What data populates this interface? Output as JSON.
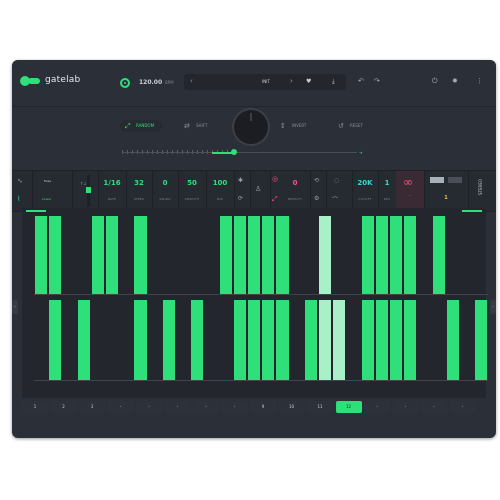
{
  "header": {
    "brand": "gatelab",
    "bpm": "120.00",
    "bpm_unit": "BPM",
    "preset_name": "INIT",
    "prev_arrow": "‹",
    "next_arrow": "›",
    "heart_icon": "♥",
    "download_icon": "⤓",
    "undo_icon": "↶",
    "redo_icon": "↷",
    "power_icon": "⏻",
    "settings_icon": "✹",
    "menu_icon": "⋮"
  },
  "modes": [
    {
      "label": "RANDOM",
      "icon": "⤢"
    },
    {
      "label": "SHIFT",
      "icon": "⇄"
    },
    {
      "label": "INVERT",
      "icon": "↕"
    },
    {
      "label": "RESET",
      "icon": "↺"
    }
  ],
  "controls": {
    "shape_a": "Ease",
    "shape_b": "Linear",
    "rate": {
      "value": "1/16",
      "label": "RATE"
    },
    "steps": {
      "value": "32",
      "label": "STEPS"
    },
    "swing": {
      "value": "0",
      "label": "SWING"
    },
    "smooth": {
      "value": "50",
      "label": "SMOOTH"
    },
    "mix": {
      "value": "100",
      "label": "MIX"
    },
    "density": {
      "value": "0",
      "label": "DENSITY"
    },
    "cutoff": {
      "value": "20K",
      "label": "CUTOFF"
    },
    "res": {
      "value": "1",
      "label": "RES"
    },
    "lfo_value": "1",
    "side_tab": "STEREO"
  },
  "pattern": {
    "lane1": [
      1,
      1,
      0,
      0,
      1,
      1,
      0,
      1,
      0,
      0,
      0,
      0,
      0,
      1,
      1,
      1,
      1,
      1,
      0,
      0,
      2,
      0,
      0,
      1,
      1,
      1,
      1,
      0,
      1,
      0,
      0,
      0
    ],
    "lane2": [
      0,
      1,
      0,
      1,
      0,
      0,
      0,
      1,
      0,
      1,
      0,
      1,
      0,
      0,
      1,
      1,
      1,
      1,
      0,
      1,
      2,
      2,
      0,
      1,
      1,
      1,
      1,
      0,
      0,
      1,
      0,
      1
    ]
  },
  "pages": [
    "1",
    "2",
    "3",
    "•",
    "•",
    "•",
    "•",
    "•",
    "9",
    "10",
    "11",
    "12",
    "•",
    "•",
    "•",
    "•"
  ],
  "selected_page": "12",
  "colors": {
    "accent": "#2fe07a",
    "selected_step": "#a7f0c8",
    "background": "#2b2f37",
    "danger": "#ff4f7a",
    "cutoff": "#3ad6d0"
  }
}
